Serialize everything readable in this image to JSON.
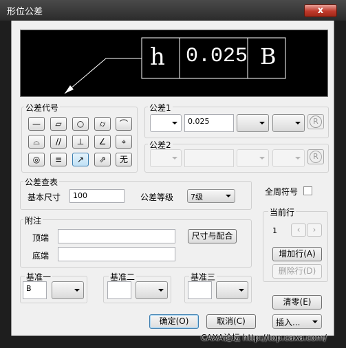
{
  "window": {
    "title": "形位公差",
    "close_glyph": "x"
  },
  "preview": {
    "symbol": "h",
    "value": "0.025",
    "datum": "B"
  },
  "tolerance_code": {
    "label": "公差代号",
    "symbols": [
      "—",
      "▱",
      "○",
      "⌭",
      "⌒",
      "⌓",
      "//",
      "⊥",
      "∠",
      "⌖",
      "◎",
      "≡",
      "↗",
      "⇗",
      "无"
    ]
  },
  "tolerance1": {
    "label": "公差1",
    "value": "0.025"
  },
  "tolerance2": {
    "label": "公差2",
    "value": ""
  },
  "lookup": {
    "label": "公差查表",
    "basic_size_label": "基本尺寸",
    "basic_size_value": "100",
    "grade_label": "公差等级",
    "grade_value": "7级"
  },
  "all_around": {
    "label": "全周符号"
  },
  "current_row": {
    "label": "当前行",
    "value": "1",
    "prev": "‹",
    "next": "›",
    "add_label": "增加行(A)",
    "delete_label": "删除行(D)"
  },
  "notes": {
    "label": "附注",
    "top_label": "顶端",
    "bottom_label": "底端",
    "fit_button": "尺寸与配合"
  },
  "datum1": {
    "label": "基准一",
    "value": "B"
  },
  "datum2": {
    "label": "基准二",
    "value": ""
  },
  "datum3": {
    "label": "基准三",
    "value": ""
  },
  "buttons": {
    "clear": "清零(E)",
    "ok": "确定(O)",
    "cancel": "取消(C)",
    "insert": "插入..."
  },
  "r_symbol": "R",
  "watermark": "CAXA论坛 http://top.caxa.com/"
}
